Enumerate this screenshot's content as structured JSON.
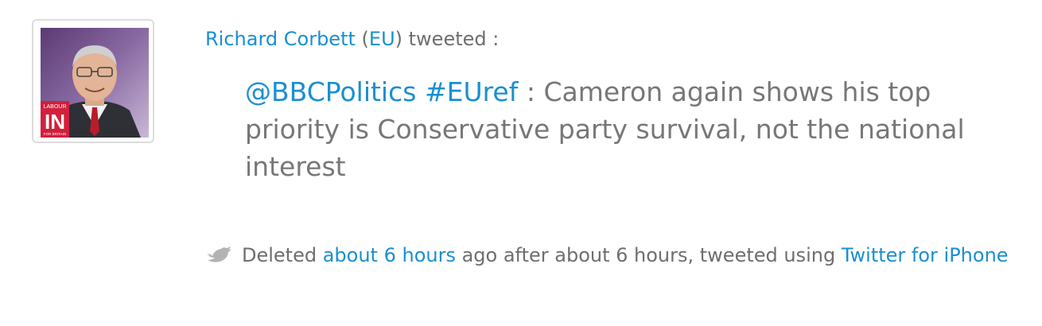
{
  "tweet": {
    "author_name": "Richard Corbett",
    "author_tag_open": " (",
    "author_tag": "EU",
    "author_tag_close": ")",
    "action": " tweeted :",
    "mention": "@BBCPolitics",
    "hashtag": "#EUref",
    "body": " : Cameron again shows his top priority is Conservative party survival, not the national interest"
  },
  "avatar": {
    "badge_line1": "LABOUR",
    "badge_line2": "IN",
    "badge_line3": "FOR BRITAIN"
  },
  "meta": {
    "icon": "twitter-bird-icon",
    "deleted_label": "Deleted ",
    "deleted_time": "about 6 hours",
    "after_text": " ago after about 6 hours, tweeted using ",
    "client": "Twitter for iPhone"
  },
  "colors": {
    "link": "#1a8fd1",
    "text": "#777777",
    "badge_red": "#d31f3c"
  }
}
